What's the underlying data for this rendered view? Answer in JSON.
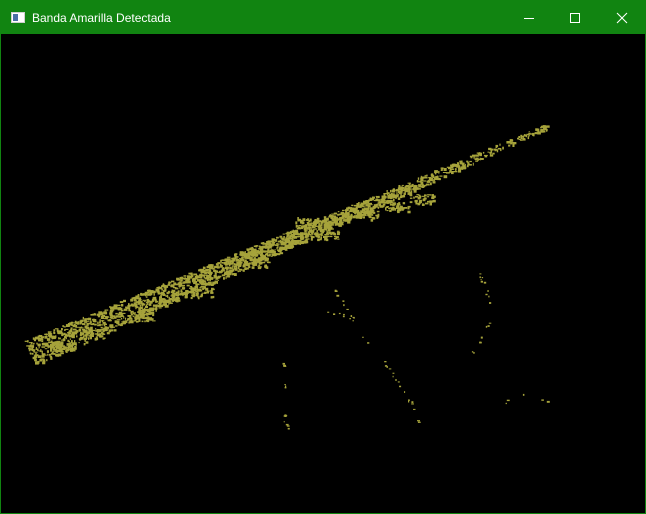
{
  "window": {
    "title": "Banda Amarilla Detectada",
    "titlebar_color": "#118411",
    "controls": {
      "minimize_icon": "minimize-icon",
      "maximize_icon": "maximize-icon",
      "close_icon": "close-icon"
    }
  },
  "image": {
    "background": "#000000",
    "mask_color": "#a6a33b",
    "description_icon": "detected-yellow-band-mask"
  }
}
